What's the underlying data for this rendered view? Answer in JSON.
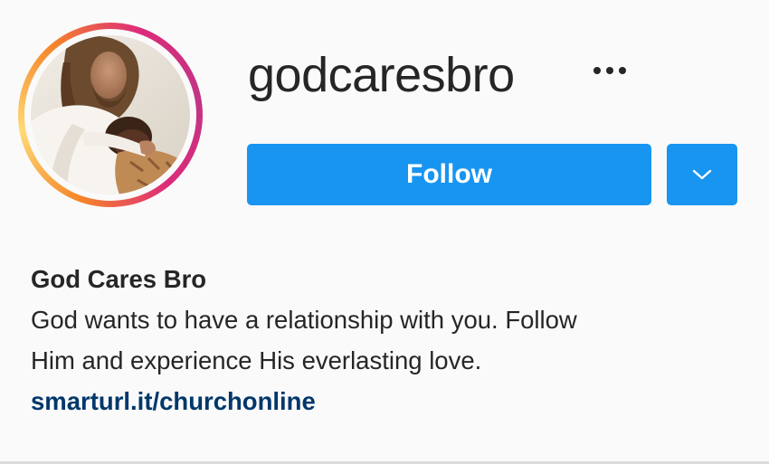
{
  "profile": {
    "username": "godcaresbro",
    "full_name": "God Cares Bro",
    "bio_lines": [
      "God wants to have a relationship with you. Follow",
      "Him and experience His everlasting love."
    ],
    "link": "smarturl.it/churchonline",
    "avatar_description": "profile-photo"
  },
  "actions": {
    "follow_label": "Follow",
    "more_options_icon": "ellipsis-icon",
    "dropdown_icon": "chevron-down-icon"
  },
  "colors": {
    "background": "#fafafa",
    "text": "#262626",
    "follow_button": "#1795f1",
    "link": "#00376b",
    "story_ring_start": "#f58529",
    "story_ring_end": "#c13584"
  }
}
